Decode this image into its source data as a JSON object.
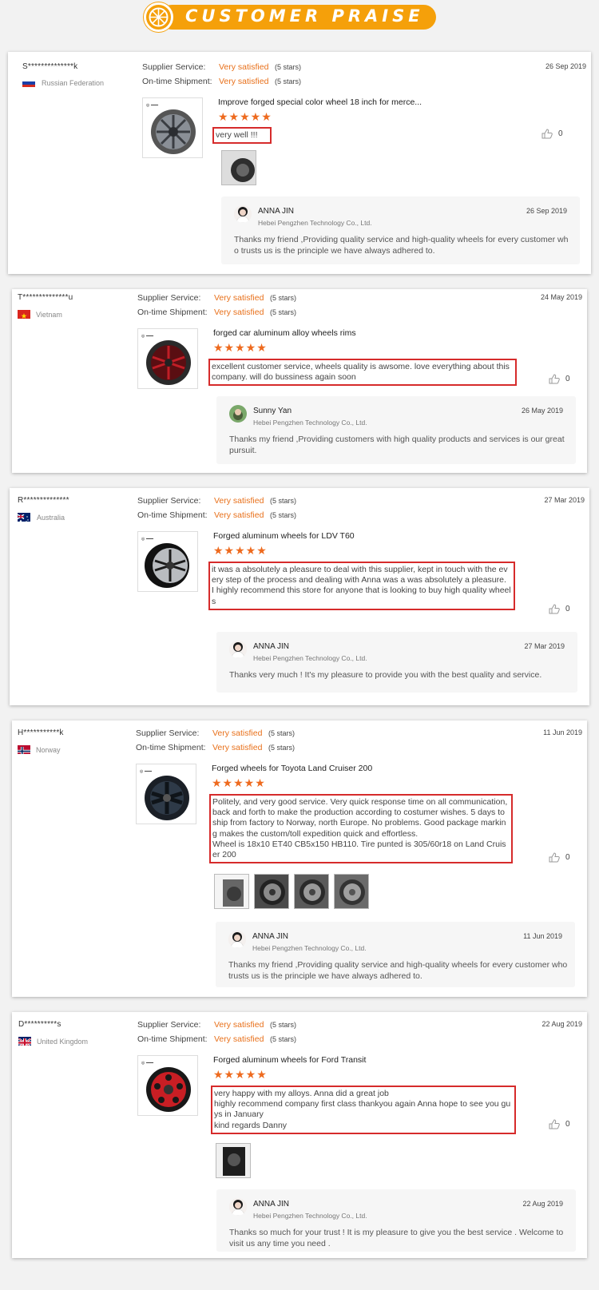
{
  "banner": {
    "title": "CUSTOMER PRAISE"
  },
  "labels": {
    "supplier_service": "Supplier Service:",
    "ontime_shipment": "On-time Shipment:"
  },
  "colors": {
    "accent": "#e8701a",
    "banner": "#f5a00a",
    "highlight_border": "#d62b2b",
    "star": "#ee6a1e"
  },
  "reviews": [
    {
      "reviewer": "S**************k",
      "country": "Russian Federation",
      "flag": "russia-flag",
      "supplier_service": "Very satisfied",
      "supplier_stars": "(5 stars)",
      "shipment": "Very satisfied",
      "shipment_stars": "(5 stars)",
      "date": "26 Sep 2019",
      "product": "Improve forged special color wheel 18 inch for merce...",
      "rating": 5,
      "stars": "★★★★★",
      "comment": "very well !!!",
      "likes": "0",
      "reply": {
        "name": "ANNA JIN",
        "company": "Hebei Pengzhen Technology Co., Ltd.",
        "date": "26 Sep 2019",
        "text": "Thanks my friend ,Providing quality service and high-quality wheels for every customer who trusts us is the principle we have always adhered to."
      }
    },
    {
      "reviewer": "T**************u",
      "country": "Vietnam",
      "flag": "vietnam-flag",
      "supplier_service": "Very satisfied",
      "supplier_stars": "(5 stars)",
      "shipment": "Very satisfied",
      "shipment_stars": "(5 stars)",
      "date": "24 May 2019",
      "product": "forged car aluminum alloy wheels rims",
      "rating": 5,
      "stars": "★★★★★",
      "comment": "excellent customer service, wheels quality is awsome. love everything about this company. will do bussiness again soon",
      "likes": "0",
      "reply": {
        "name": "Sunny Yan",
        "company": "Hebei Pengzhen Technology Co., Ltd.",
        "date": "26 May 2019",
        "text": "Thanks my friend ,Providing customers with high quality products and services is our great pursuit."
      }
    },
    {
      "reviewer": "R**************",
      "country": "Australia",
      "flag": "australia-flag",
      "supplier_service": "Very satisfied",
      "supplier_stars": "(5 stars)",
      "shipment": "Very satisfied",
      "shipment_stars": "(5 stars)",
      "date": "27 Mar 2019",
      "product": "Forged aluminum wheels for LDV T60",
      "rating": 5,
      "stars": "★★★★★",
      "comment": "it was a absolutely a pleasure to deal with this supplier, kept in touch with the every step of the process and dealing with Anna was a was absolutely a pleasure.\nI highly recommend this store for anyone that is looking to buy high quality wheels",
      "likes": "0",
      "reply": {
        "name": "ANNA JIN",
        "company": "Hebei Pengzhen Technology Co., Ltd.",
        "date": "27 Mar 2019",
        "text": "Thanks very much ! It's my pleasure to provide you with the best quality and service."
      }
    },
    {
      "reviewer": "H***********k",
      "country": "Norway",
      "flag": "norway-flag",
      "supplier_service": "Very satisfied",
      "supplier_stars": "(5 stars)",
      "shipment": "Very satisfied",
      "shipment_stars": "(5 stars)",
      "date": "11 Jun 2019",
      "product": "Forged wheels for Toyota Land Cruiser 200",
      "rating": 5,
      "stars": "★★★★★",
      "comment": "Politely, and very good service. Very quick response time on all communication, back and forth to make the production according to costumer wishes. 5 days to ship from factory to Norway, north Europe. No problems. Good package marking makes the custom/toll expedition quick and effortless.\nWheel is 18x10 ET40 CB5x150 HB110. Tire punted is 305/60r18 on Land Cruiser 200",
      "likes": "0",
      "reply": {
        "name": "ANNA JIN",
        "company": "Hebei Pengzhen Technology Co., Ltd.",
        "date": "11 Jun 2019",
        "text": "Thanks my friend ,Providing quality service and high-quality wheels for every customer who trusts us is the principle we have always adhered to."
      }
    },
    {
      "reviewer": "D**********s",
      "country": "United Kingdom",
      "flag": "uk-flag",
      "supplier_service": "Very satisfied",
      "supplier_stars": "(5 stars)",
      "shipment": "Very satisfied",
      "shipment_stars": "(5 stars)",
      "date": "22 Aug 2019",
      "product": "Forged aluminum wheels for Ford Transit",
      "rating": 5,
      "stars": "★★★★★",
      "comment": "very happy with my alloys. Anna did a great job\nhighly recommend company first class thankyou again Anna hope to see you guys in January\nkind regards Danny",
      "likes": "0",
      "reply": {
        "name": "ANNA JIN",
        "company": "Hebei Pengzhen Technology Co., Ltd.",
        "date": "22 Aug 2019",
        "text": "Thanks so much for your trust ! It is my pleasure to give you the best service . Welcome to visit us any time you need ."
      }
    }
  ]
}
